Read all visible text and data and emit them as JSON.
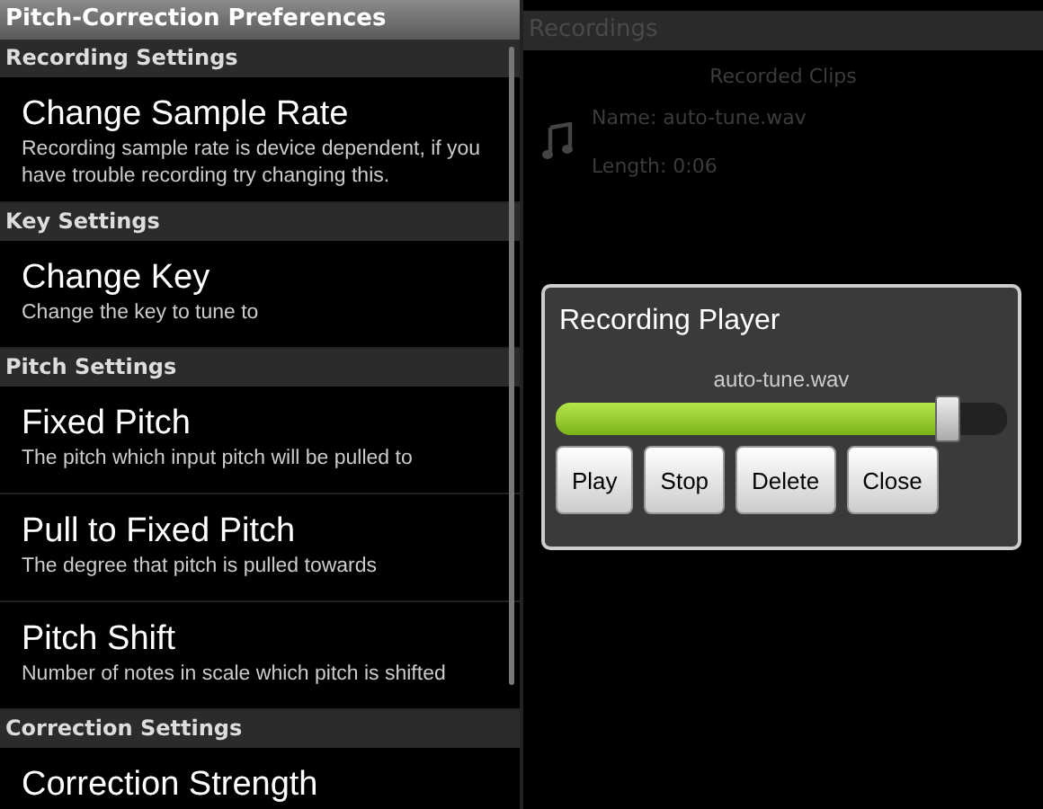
{
  "preferences": {
    "title": "Pitch-Correction Preferences",
    "sections": [
      {
        "header": "Recording Settings",
        "items": [
          {
            "title": "Change Sample Rate",
            "summary": "Recording sample rate is device dependent, if you have trouble recording try changing this."
          }
        ]
      },
      {
        "header": "Key Settings",
        "items": [
          {
            "title": "Change Key",
            "summary": "Change the key to tune to"
          }
        ]
      },
      {
        "header": "Pitch Settings",
        "items": [
          {
            "title": "Fixed Pitch",
            "summary": "The pitch which input pitch will be pulled to"
          },
          {
            "title": "Pull to Fixed Pitch",
            "summary": "The degree that pitch is pulled towards"
          },
          {
            "title": "Pitch Shift",
            "summary": "Number of notes in scale which pitch is shifted"
          }
        ]
      },
      {
        "header": "Correction Settings",
        "items": [
          {
            "title": "Correction Strength"
          }
        ]
      }
    ]
  },
  "recordings": {
    "title": "Recordings",
    "list_title": "Recorded Clips",
    "clips": [
      {
        "name": "Name: auto-tune.wav",
        "length": "Length: 0:06"
      }
    ]
  },
  "dialog": {
    "title": "Recording Player",
    "file": "auto-tune.wav",
    "slider": {
      "level": 0.87
    },
    "buttons": [
      "Play",
      "Stop",
      "Delete",
      "Close"
    ]
  }
}
